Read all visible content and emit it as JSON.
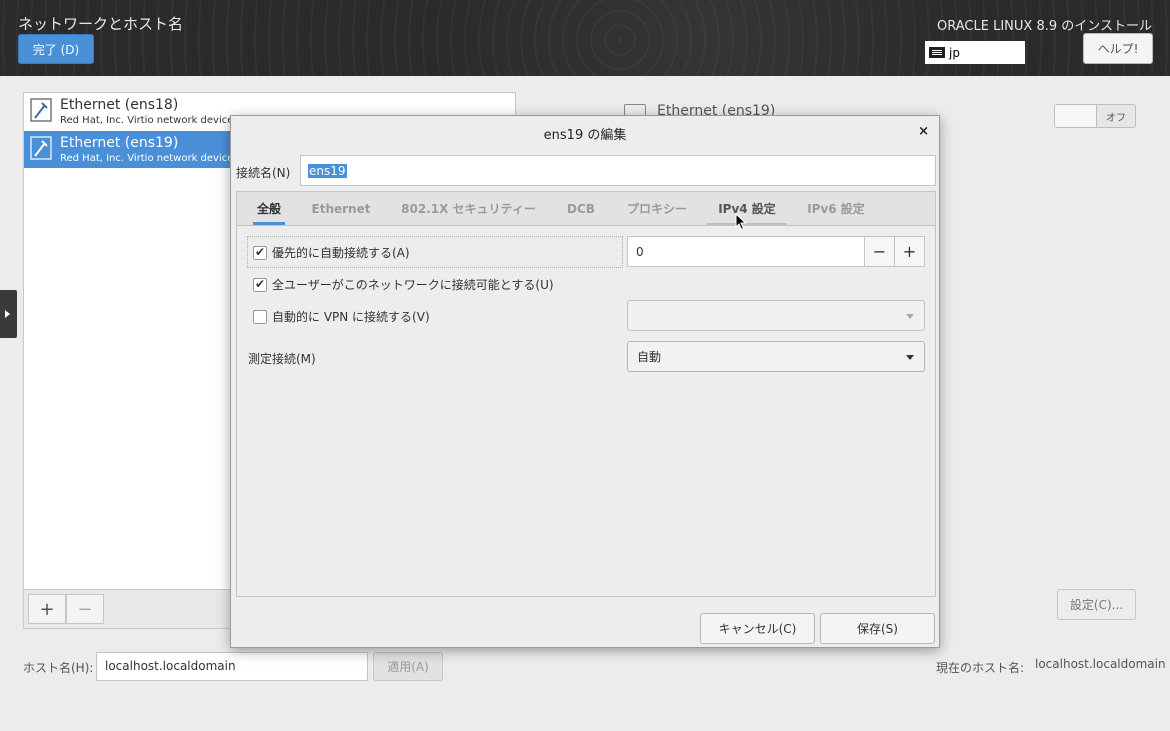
{
  "header": {
    "title": "ネットワークとホスト名",
    "done_label": "完了 (D)",
    "product": "ORACLE LINUX 8.9 のインストール",
    "keyboard": "jp",
    "help_label": "ヘルプ!"
  },
  "devices": [
    {
      "name": "Ethernet (ens18)",
      "desc": "Red Hat, Inc. Virtio network device",
      "selected": false
    },
    {
      "name": "Ethernet (ens19)",
      "desc": "Red Hat, Inc. Virtio network device",
      "selected": true
    }
  ],
  "toolbar": {
    "add": "+",
    "remove": "−"
  },
  "detail": {
    "title": "Ethernet (ens19)",
    "switch_label": "オフ",
    "settings_label": "設定(C)..."
  },
  "hostname": {
    "label": "ホスト名(H):",
    "value": "localhost.localdomain",
    "apply_label": "適用(A)",
    "current_label": "現在のホスト名:",
    "current_value": "localhost.localdomain"
  },
  "dialog": {
    "title": "ens19 の編集",
    "close": "×",
    "conn_name_label": "接続名(N)",
    "conn_name_value": "ens19",
    "tabs": [
      "全般",
      "Ethernet",
      "802.1X セキュリティー",
      "DCB",
      "プロキシー",
      "IPv4 設定",
      "IPv6 設定"
    ],
    "active_tab": "全般",
    "auto_connect_label": "優先的に自動接続する(A)",
    "auto_connect_checked": true,
    "priority_value": "0",
    "priority_minus": "−",
    "priority_plus": "+",
    "all_users_label": "全ユーザーがこのネットワークに接続可能とする(U)",
    "all_users_checked": true,
    "vpn_label": "自動的に VPN に接続する(V)",
    "vpn_checked": false,
    "metered_label": "測定接続(M)",
    "metered_value": "自動",
    "cancel_label": "キャンセル(C)",
    "save_label": "保存(S)"
  },
  "colors": {
    "accent": "#4a90d9",
    "header_bg": "#2b2a28"
  }
}
